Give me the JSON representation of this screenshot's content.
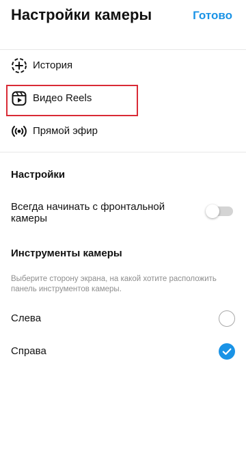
{
  "header": {
    "title": "Настройки камеры",
    "done_label": "Готово"
  },
  "camera_modes": [
    {
      "label": "История",
      "icon": "story-add-icon"
    },
    {
      "label": "Видео Reels",
      "icon": "reels-icon"
    },
    {
      "label": "Прямой эфир",
      "icon": "live-broadcast-icon"
    }
  ],
  "settings": {
    "heading": "Настройки",
    "front_camera_label": "Всегда начинать с фронтальной камеры",
    "front_camera_enabled": false
  },
  "tools": {
    "heading": "Инструменты камеры",
    "hint": "Выберите сторону экрана, на какой хотите расположить панель инструментов камеры.",
    "options": [
      {
        "label": "Слева",
        "selected": false
      },
      {
        "label": "Справа",
        "selected": true
      }
    ]
  },
  "colors": {
    "accent": "#1a93e6",
    "highlight": "#d92a35",
    "toggle_off": "#d4d4d4"
  }
}
